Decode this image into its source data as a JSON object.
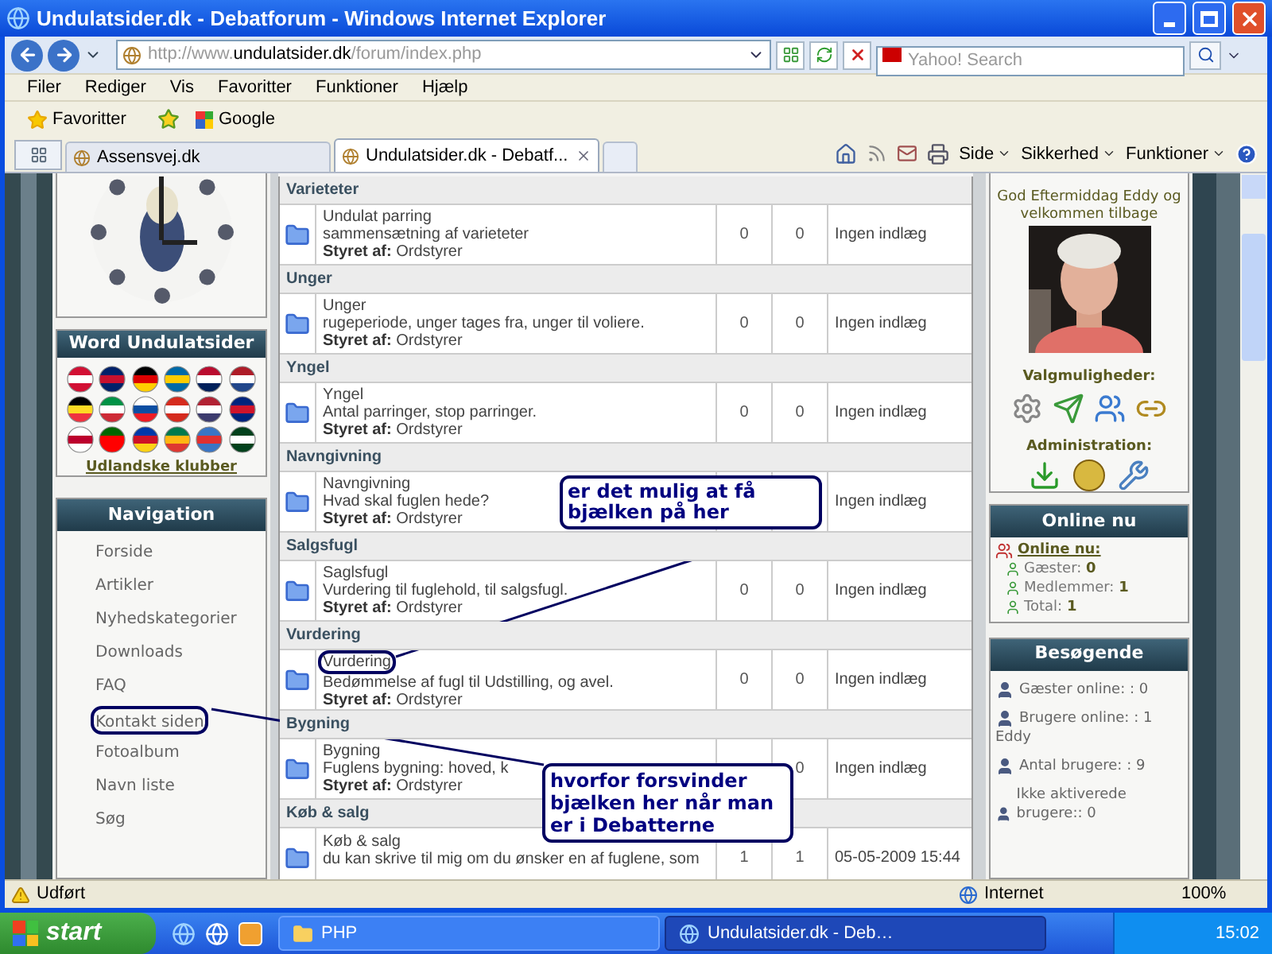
{
  "window": {
    "title": "Undulatsider.dk - Debatforum - Windows Internet Explorer"
  },
  "address_bar": {
    "url_scheme": "http://www.",
    "url_host": "undulatsider.dk",
    "url_path": "/forum/index.php"
  },
  "search": {
    "placeholder": "Yahoo! Search"
  },
  "menu": [
    "Filer",
    "Rediger",
    "Vis",
    "Favoritter",
    "Funktioner",
    "Hjælp"
  ],
  "favorites_bar": {
    "favorites": "Favoritter",
    "links": [
      "Google"
    ]
  },
  "tabs": [
    {
      "label": "Assensvej.dk",
      "selected": false
    },
    {
      "label": "Undulatsider.dk - Debatf...",
      "selected": true
    }
  ],
  "command_bar": [
    "Side",
    "Sikkerhed",
    "Funktioner"
  ],
  "left": {
    "word_panel": {
      "title": "Word Undulatsider",
      "link": "Udlandske klubber"
    },
    "navigation": {
      "title": "Navigation",
      "items": [
        {
          "label": "Forside",
          "circled": false
        },
        {
          "label": "Artikler",
          "circled": false
        },
        {
          "label": "Nyhedskategorier",
          "circled": false
        },
        {
          "label": "Downloads",
          "circled": false
        },
        {
          "label": "FAQ",
          "circled": false
        },
        {
          "label": "Kontakt siden",
          "circled": true
        },
        {
          "label": "Fotoalbum",
          "circled": false
        },
        {
          "label": "Navn liste",
          "circled": false
        },
        {
          "label": "Søg",
          "circled": false
        }
      ]
    }
  },
  "forum": {
    "categories": [
      {
        "name": "Varieteter",
        "forum": {
          "title": "Undulat parring",
          "circled": false,
          "description": "sammensætning af varieteter",
          "moderator_label": "Styret af:",
          "moderator": "Ordstyrer",
          "topics": "0",
          "posts": "0",
          "last_post": "Ingen indlæg"
        }
      },
      {
        "name": "Unger",
        "forum": {
          "title": "Unger",
          "circled": false,
          "description": "rugeperiode, unger tages fra, unger til voliere.",
          "moderator_label": "Styret af:",
          "moderator": "Ordstyrer",
          "topics": "0",
          "posts": "0",
          "last_post": "Ingen indlæg"
        }
      },
      {
        "name": "Yngel",
        "forum": {
          "title": "Yngel",
          "circled": false,
          "description": "Antal parringer, stop parringer.",
          "moderator_label": "Styret af:",
          "moderator": "Ordstyrer",
          "topics": "0",
          "posts": "0",
          "last_post": "Ingen indlæg"
        }
      },
      {
        "name": "Navngivning",
        "forum": {
          "title": "Navngivning",
          "circled": false,
          "description": "Hvad skal fuglen hede?",
          "moderator_label": "Styret af:",
          "moderator": "Ordstyrer",
          "last_post": "Ingen indlæg"
        }
      },
      {
        "name": "Salgsfugl",
        "forum": {
          "title": "Saglsfugl",
          "circled": false,
          "description": "Vurdering til fuglehold, til salgsfugl.",
          "moderator_label": "Styret af:",
          "moderator": "Ordstyrer",
          "topics": "0",
          "posts": "0",
          "last_post": "Ingen indlæg"
        }
      },
      {
        "name": "Vurdering",
        "forum": {
          "title": "Vurdering",
          "circled": true,
          "description": "Bedømmelse af fugl til Udstilling, og avel.",
          "moderator_label": "Styret af:",
          "moderator": "Ordstyrer",
          "topics": "0",
          "posts": "0",
          "last_post": "Ingen indlæg"
        }
      },
      {
        "name": "Bygning",
        "forum": {
          "title": "Bygning",
          "circled": false,
          "description": "Fuglens bygning: hoved, k",
          "moderator_label": "Styret af:",
          "moderator": "Ordstyrer",
          "posts": "0",
          "last_post": "Ingen indlæg"
        }
      },
      {
        "name": "Køb & salg",
        "forum": {
          "title": "Køb & salg",
          "circled": false,
          "description": "du kan skrive til mig om du ønsker en af fuglene, som",
          "topics": "1",
          "posts": "1",
          "last_post": "05-05-2009 15:44"
        }
      }
    ]
  },
  "right": {
    "greeting": "God Eftermiddag Eddy og velkommen tilbage",
    "options_title": "Valgmuligheder:",
    "admin_title": "Administration:",
    "online": {
      "title": "Online nu",
      "heading": "Online nu:",
      "stats": [
        {
          "label": "Gæster:",
          "value": "0"
        },
        {
          "label": "Medlemmer:",
          "value": "1"
        },
        {
          "label": "Total:",
          "value": "1"
        }
      ]
    },
    "visitors": {
      "title": "Besøgende",
      "items": [
        {
          "label": "Gæster online: : 0"
        },
        {
          "label": "Brugere online: : 1",
          "detail": "Eddy"
        },
        {
          "label": "Antal brugere: : 9"
        },
        {
          "label": "Ikke aktiverede brugere:: 0"
        }
      ]
    }
  },
  "annotations": [
    {
      "text": "er det mulig at få bjælken på her"
    },
    {
      "text": "hvorfor forsvinder bjælken her når man er i Debatterne"
    }
  ],
  "status_bar": {
    "text": "Udført",
    "zone": "Internet",
    "zoom": "100%"
  },
  "taskbar": {
    "start": "start",
    "items": [
      {
        "label": "PHP",
        "selected": false
      },
      {
        "label": "Undulatsider.dk - Deb…",
        "selected": true
      }
    ],
    "clock": "15:02"
  }
}
